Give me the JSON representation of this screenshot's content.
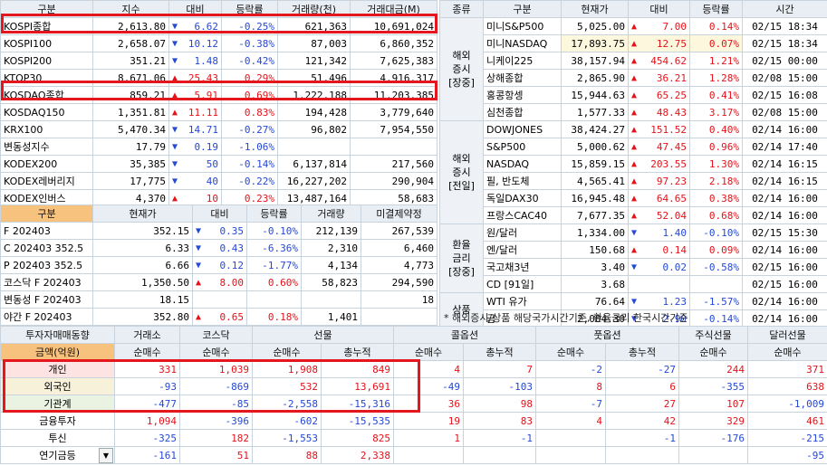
{
  "domestic_indices": {
    "headers": [
      "구분",
      "지수",
      "대비",
      "등락률",
      "거래량(천)",
      "거래대금(M)"
    ],
    "rows": [
      {
        "name": "KOSPI종합",
        "value": "2,613.80",
        "dir": "down",
        "change": "6.62",
        "rate": "-0.25%",
        "volume": "621,363",
        "amount": "10,691,024"
      },
      {
        "name": "KOSPI100",
        "value": "2,658.07",
        "dir": "down",
        "change": "10.12",
        "rate": "-0.38%",
        "volume": "87,003",
        "amount": "6,860,352"
      },
      {
        "name": "KOSPI200",
        "value": "351.21",
        "dir": "down",
        "change": "1.48",
        "rate": "-0.42%",
        "volume": "121,342",
        "amount": "7,625,383"
      },
      {
        "name": "KTOP30",
        "value": "8,671.06",
        "dir": "up",
        "change": "25.43",
        "rate": "0.29%",
        "volume": "51,496",
        "amount": "4,916,317"
      },
      {
        "name": "KOSDAQ종합",
        "value": "859.21",
        "dir": "up",
        "change": "5.91",
        "rate": "0.69%",
        "volume": "1,222,188",
        "amount": "11,203,385"
      },
      {
        "name": "KOSDAQ150",
        "value": "1,351.81",
        "dir": "up",
        "change": "11.11",
        "rate": "0.83%",
        "volume": "194,428",
        "amount": "3,779,640"
      },
      {
        "name": "KRX100",
        "value": "5,470.34",
        "dir": "down",
        "change": "14.71",
        "rate": "-0.27%",
        "volume": "96,802",
        "amount": "7,954,550"
      },
      {
        "name": "변동성지수",
        "value": "17.79",
        "dir": "down",
        "change": "0.19",
        "rate": "-1.06%",
        "volume": "",
        "amount": ""
      },
      {
        "name": "KODEX200",
        "value": "35,385",
        "dir": "down",
        "change": "50",
        "rate": "-0.14%",
        "volume": "6,137,814",
        "amount": "217,560"
      },
      {
        "name": "KODEX레버리지",
        "value": "17,775",
        "dir": "down",
        "change": "40",
        "rate": "-0.22%",
        "volume": "16,227,202",
        "amount": "290,904"
      },
      {
        "name": "KODEX인버스",
        "value": "4,370",
        "dir": "up",
        "change": "10",
        "rate": "0.23%",
        "volume": "13,487,164",
        "amount": "58,683"
      }
    ]
  },
  "derivatives": {
    "headers": [
      "구분",
      "현재가",
      "대비",
      "등락률",
      "거래량",
      "미결제약정"
    ],
    "rows": [
      {
        "name": "F 202403",
        "value": "352.15",
        "dir": "down",
        "change": "0.35",
        "rate": "-0.10%",
        "volume": "212,139",
        "oi": "267,539"
      },
      {
        "name": "C 202403 352.5",
        "value": "6.33",
        "dir": "down",
        "change": "0.43",
        "rate": "-6.36%",
        "volume": "2,310",
        "oi": "6,460"
      },
      {
        "name": "P 202403 352.5",
        "value": "6.66",
        "dir": "down",
        "change": "0.12",
        "rate": "-1.77%",
        "volume": "4,134",
        "oi": "4,773"
      },
      {
        "name": "코스닥 F 202403",
        "value": "1,350.50",
        "dir": "up",
        "change": "8.00",
        "rate": "0.60%",
        "volume": "58,823",
        "oi": "294,590"
      },
      {
        "name": "변동성 F 202403",
        "value": "18.15",
        "dir": "",
        "change": "",
        "rate": "",
        "volume": "",
        "oi": "18"
      },
      {
        "name": "야간 F 202403",
        "value": "352.80",
        "dir": "up",
        "change": "0.65",
        "rate": "0.18%",
        "volume": "1,401",
        "oi": ""
      }
    ]
  },
  "world": {
    "headers": [
      "종류",
      "구분",
      "현재가",
      "대비",
      "등락률",
      "시간"
    ],
    "groups": [
      {
        "label": "해외\n증시\n[장중]",
        "rows": [
          {
            "name": "미니S&P500",
            "value": "5,025.00",
            "dir": "up",
            "change": "7.00",
            "rate": "0.14%",
            "time": "02/15 18:34"
          },
          {
            "name": "미니NASDAQ",
            "value": "17,893.75",
            "dir": "up",
            "change": "12.75",
            "rate": "0.07%",
            "time": "02/15 18:34",
            "hl": true
          },
          {
            "name": "니케이225",
            "value": "38,157.94",
            "dir": "up",
            "change": "454.62",
            "rate": "1.21%",
            "time": "02/15 00:00"
          },
          {
            "name": "상해종합",
            "value": "2,865.90",
            "dir": "up",
            "change": "36.21",
            "rate": "1.28%",
            "time": "02/08 15:00"
          },
          {
            "name": "홍콩항셍",
            "value": "15,944.63",
            "dir": "up",
            "change": "65.25",
            "rate": "0.41%",
            "time": "02/15 16:08"
          },
          {
            "name": "심천종합",
            "value": "1,577.33",
            "dir": "up",
            "change": "48.43",
            "rate": "3.17%",
            "time": "02/08 15:00"
          }
        ]
      },
      {
        "label": "해외\n증시\n[전일]",
        "rows": [
          {
            "name": "DOWJONES",
            "value": "38,424.27",
            "dir": "up",
            "change": "151.52",
            "rate": "0.40%",
            "time": "02/14 16:00"
          },
          {
            "name": "S&P500",
            "value": "5,000.62",
            "dir": "up",
            "change": "47.45",
            "rate": "0.96%",
            "time": "02/14 17:40"
          },
          {
            "name": "NASDAQ",
            "value": "15,859.15",
            "dir": "up",
            "change": "203.55",
            "rate": "1.30%",
            "time": "02/14 16:15"
          },
          {
            "name": "필, 반도체",
            "value": "4,565.41",
            "dir": "up",
            "change": "97.23",
            "rate": "2.18%",
            "time": "02/14 16:15"
          },
          {
            "name": "독일DAX30",
            "value": "16,945.48",
            "dir": "up",
            "change": "64.65",
            "rate": "0.38%",
            "time": "02/14 16:00"
          },
          {
            "name": "프랑스CAC40",
            "value": "7,677.35",
            "dir": "up",
            "change": "52.04",
            "rate": "0.68%",
            "time": "02/14 16:00"
          }
        ]
      },
      {
        "label": "환율\n금리\n[장중]",
        "rows": [
          {
            "name": "원/달러",
            "value": "1,334.00",
            "dir": "down",
            "change": "1.40",
            "rate": "-0.10%",
            "time": "02/15 15:30"
          },
          {
            "name": "엔/달러",
            "value": "150.68",
            "dir": "up",
            "change": "0.14",
            "rate": "0.09%",
            "time": "02/14 16:00"
          },
          {
            "name": "국고채3년",
            "value": "3.40",
            "dir": "down",
            "change": "0.02",
            "rate": "-0.58%",
            "time": "02/15 16:00"
          },
          {
            "name": "CD [91일]",
            "value": "3.68",
            "dir": "",
            "change": "",
            "rate": "",
            "time": "02/15 16:00"
          }
        ]
      },
      {
        "label": "상품",
        "rows": [
          {
            "name": "WTI 유가",
            "value": "76.64",
            "dir": "down",
            "change": "1.23",
            "rate": "-1.57%",
            "time": "02/14 16:00"
          },
          {
            "name": "금",
            "value": "2,004.30",
            "dir": "down",
            "change": "2.90",
            "rate": "-0.14%",
            "time": "02/14 16:00"
          }
        ]
      }
    ],
    "note": "* 해외증시/상품 해당국가시간기준, 환율금리 한국시간기준"
  },
  "investors": {
    "title": "투자자매매동향",
    "amount_label": "금액(억원)",
    "top_headers": [
      "거래소",
      "코스닥",
      "선물",
      "콜옵션",
      "풋옵션",
      "주식선물",
      "달러선물"
    ],
    "sub_headers": [
      "순매수",
      "순매수",
      "순매수",
      "총누적",
      "순매수",
      "총누적",
      "순매수",
      "총누적",
      "순매수",
      "순매수"
    ],
    "rows": [
      {
        "name": "개인",
        "cells": [
          "331",
          "1,039",
          "1,908",
          "849",
          "4",
          "7",
          "-2",
          "-27",
          "244",
          "371"
        ]
      },
      {
        "name": "외국인",
        "cells": [
          "-93",
          "-869",
          "532",
          "13,691",
          "-49",
          "-103",
          "8",
          "6",
          "-355",
          "638"
        ]
      },
      {
        "name": "기관계",
        "cells": [
          "-477",
          "-85",
          "-2,558",
          "-15,316",
          "36",
          "98",
          "-7",
          "27",
          "107",
          "-1,009"
        ]
      },
      {
        "name": "금융투자",
        "cells": [
          "1,094",
          "-396",
          "-602",
          "-15,535",
          "19",
          "83",
          "4",
          "42",
          "329",
          "461"
        ]
      },
      {
        "name": "투신",
        "cells": [
          "-325",
          "182",
          "-1,553",
          "825",
          "1",
          "-1",
          "",
          "-1",
          "-176",
          "-215"
        ]
      },
      {
        "name": "연기금등",
        "cells": [
          "-161",
          "51",
          "88",
          "2,338",
          "",
          "",
          "",
          "",
          "",
          "-95"
        ]
      }
    ],
    "dropdown_icon": "chevron-down-icon"
  },
  "colors": {
    "up": "#e5121a",
    "down": "#2448d8",
    "highlight_box": "#e4161e",
    "header": "#e9eef4",
    "orange_header": "#f7c27d"
  }
}
